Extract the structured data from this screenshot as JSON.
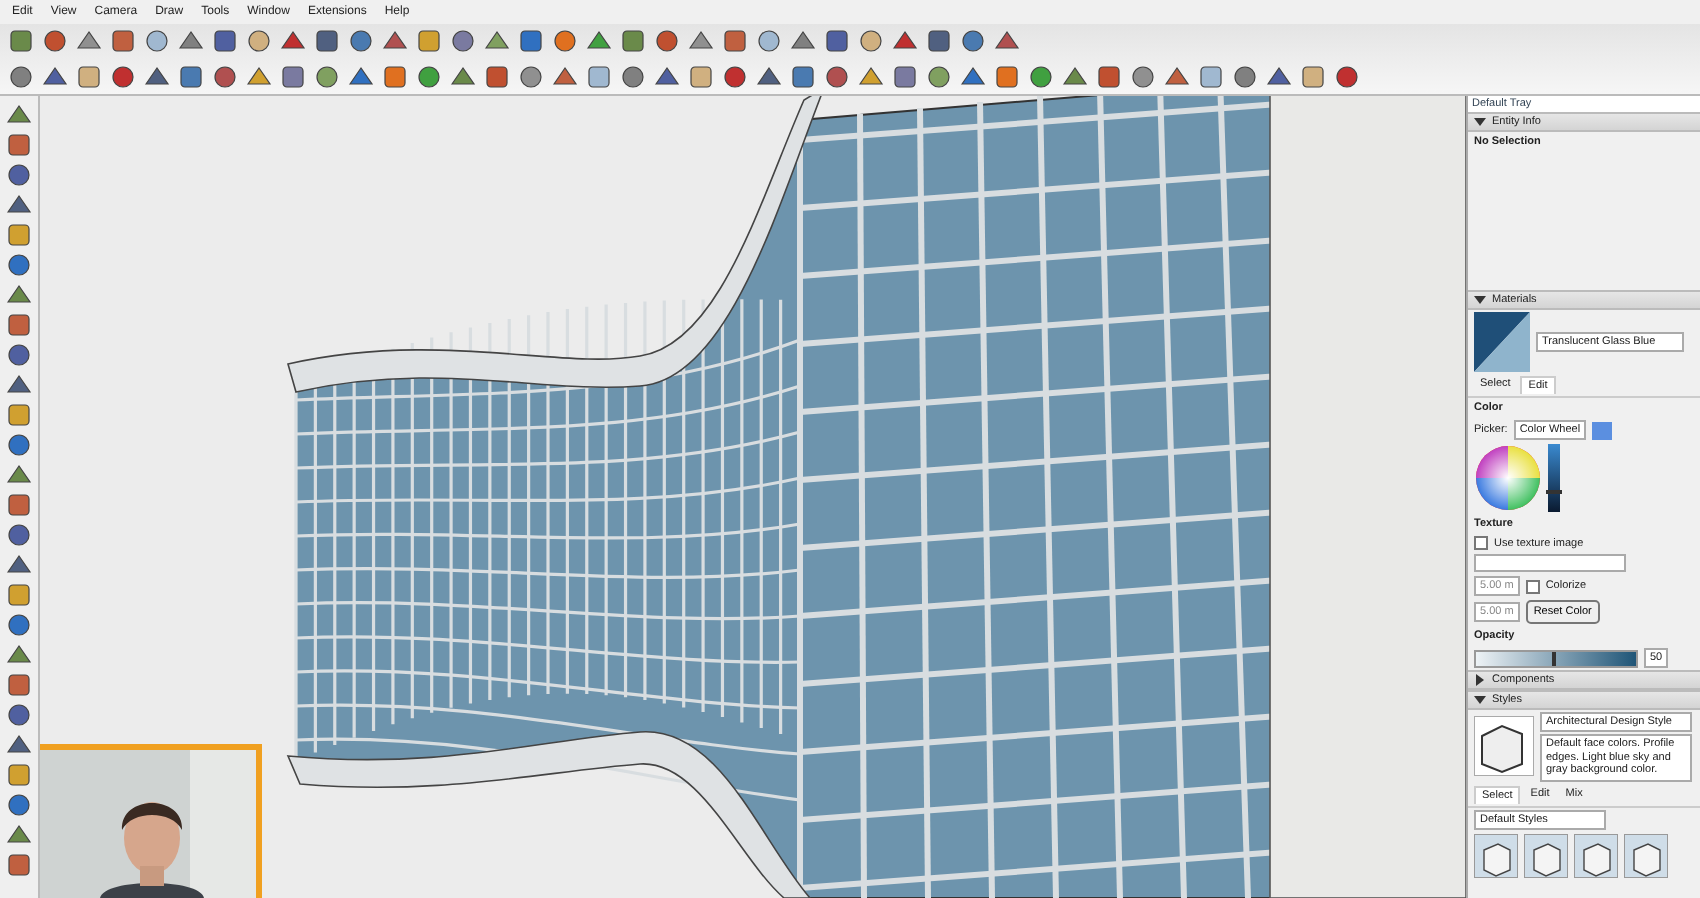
{
  "menu": [
    "Edit",
    "View",
    "Camera",
    "Draw",
    "Tools",
    "Window",
    "Extensions",
    "Help"
  ],
  "tray": {
    "title": "Default Tray",
    "entity_info": {
      "header": "Entity Info",
      "expanded": true,
      "text": "No Selection"
    },
    "materials": {
      "header": "Materials",
      "expanded": true,
      "name": "Translucent Glass Blue",
      "tabs": [
        {
          "label": "Select",
          "selected": false
        },
        {
          "label": "Edit",
          "selected": true
        }
      ],
      "color_label": "Color",
      "picker_label": "Picker:",
      "picker_value": "Color Wheel",
      "brightness": {
        "level": 0.3
      },
      "texture_label": "Texture",
      "use_texture": {
        "label": "Use texture image",
        "checked": false
      },
      "width": "5.00 m",
      "height": "5.00 m",
      "colorize": {
        "label": "Colorize",
        "checked": false
      },
      "reset": "Reset Color",
      "opacity_label": "Opacity",
      "opacity": {
        "level": 0.5,
        "value": "50"
      }
    },
    "components": {
      "header": "Components",
      "expanded": false
    },
    "styles": {
      "header": "Styles",
      "expanded": true,
      "name": "Architectural Design Style",
      "description": "Default face colors. Profile edges. Light blue sky and gray background color.",
      "tabs": [
        {
          "label": "Select",
          "selected": true
        },
        {
          "label": "Edit",
          "selected": false
        },
        {
          "label": "Mix",
          "selected": false
        }
      ],
      "collection": "Default Styles"
    }
  }
}
